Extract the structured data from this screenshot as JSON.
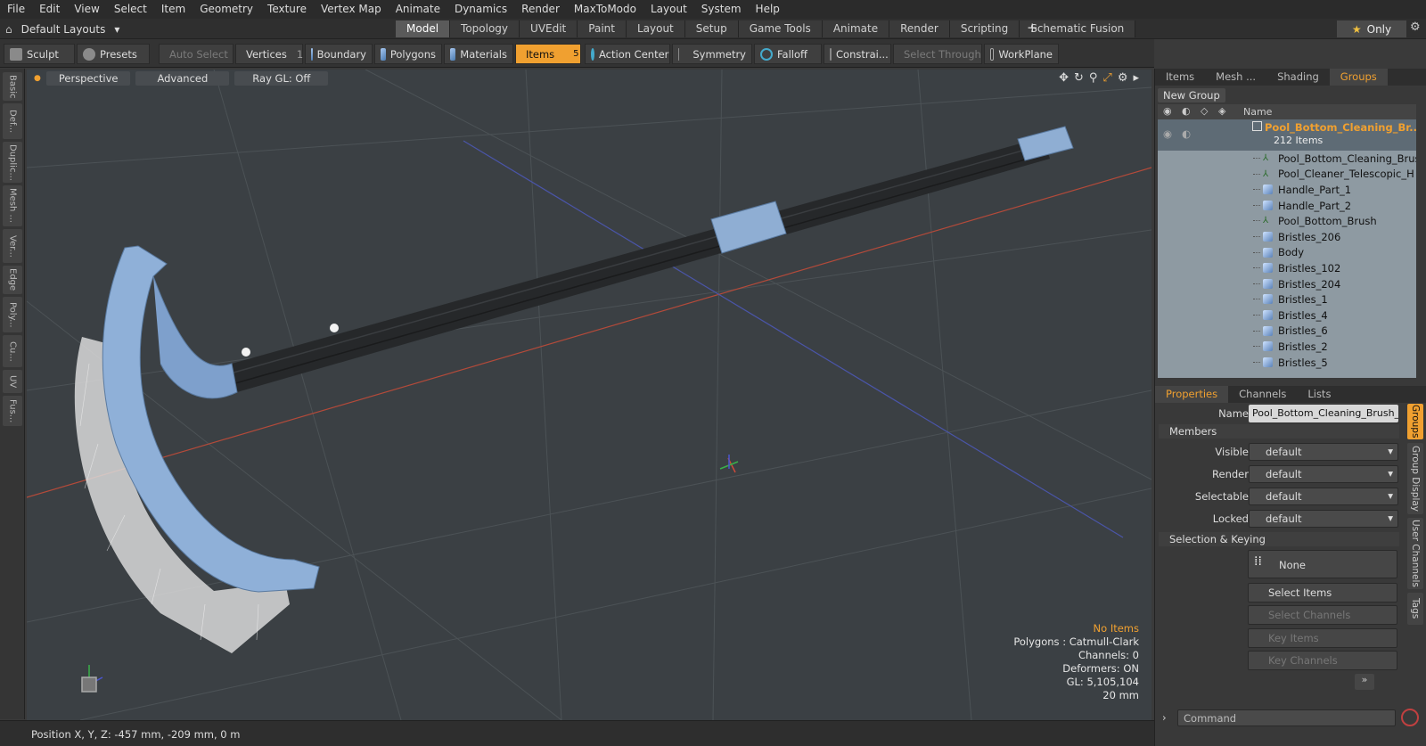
{
  "menu": [
    "File",
    "Edit",
    "View",
    "Select",
    "Item",
    "Geometry",
    "Texture",
    "Vertex Map",
    "Animate",
    "Dynamics",
    "Render",
    "MaxToModo",
    "Layout",
    "System",
    "Help"
  ],
  "layout_selector": "Default Layouts",
  "mode_tabs": [
    "Model",
    "Topology",
    "UVEdit",
    "Paint",
    "Layout",
    "Setup",
    "Game Tools",
    "Animate",
    "Render",
    "Scripting",
    "Schematic Fusion"
  ],
  "active_mode_tab": "Model",
  "only_label": "Only",
  "toolbar": {
    "sculpt": "Sculpt",
    "presets": "Presets",
    "auto_select": "Auto Select",
    "vertices": "Vertices",
    "vertices_count": "1",
    "boundary": "Boundary",
    "polygons": "Polygons",
    "materials": "Materials",
    "items": "Items",
    "items_count": "5",
    "action_center": "Action Center",
    "symmetry": "Symmetry",
    "falloff": "Falloff",
    "constraints": "Constrai...",
    "select_through": "Select Through",
    "workplane": "WorkPlane"
  },
  "left_tabs": [
    "Basic",
    "Def...",
    "Duplic...",
    "Mesh ...",
    "Ver...",
    "Edge",
    "Poly...",
    "Cu...",
    "UV",
    "Fus..."
  ],
  "viewport": {
    "view": "Perspective",
    "shading": "Advanced",
    "raygl": "Ray GL: Off",
    "info": {
      "selection": "No Items",
      "polygons": "Polygons : Catmull-Clark",
      "channels": "Channels: 0",
      "deformers": "Deformers: ON",
      "gl": "GL: 5,105,104",
      "scale": "20 mm"
    }
  },
  "status": "Position X, Y, Z:  -457 mm, -209 mm, 0 m",
  "panel_tabs": [
    "Items",
    "Mesh ...",
    "Shading",
    "Groups"
  ],
  "active_panel_tab": "Groups",
  "new_group": "New Group",
  "list_header": "Name",
  "group": {
    "name": "Pool_Bottom_Cleaning_Br...",
    "count": "212 Items"
  },
  "items": [
    {
      "name": "Pool_Bottom_Cleaning_Brus...",
      "type": "locator"
    },
    {
      "name": "Pool_Cleaner_Telescopic_H ...",
      "type": "locator"
    },
    {
      "name": "Handle_Part_1",
      "type": "mesh"
    },
    {
      "name": "Handle_Part_2",
      "type": "mesh"
    },
    {
      "name": "Pool_Bottom_Brush",
      "type": "locator"
    },
    {
      "name": "Bristles_206",
      "type": "mesh"
    },
    {
      "name": "Body",
      "type": "mesh"
    },
    {
      "name": "Bristles_102",
      "type": "mesh"
    },
    {
      "name": "Bristles_204",
      "type": "mesh"
    },
    {
      "name": "Bristles_1",
      "type": "mesh"
    },
    {
      "name": "Bristles_4",
      "type": "mesh"
    },
    {
      "name": "Bristles_6",
      "type": "mesh"
    },
    {
      "name": "Bristles_2",
      "type": "mesh"
    },
    {
      "name": "Bristles_5",
      "type": "mesh"
    }
  ],
  "props_tabs": [
    "Properties",
    "Channels",
    "Lists"
  ],
  "props": {
    "name_label": "Name",
    "name_value": "Pool_Bottom_Cleaning_Brush_wit",
    "members": "Members",
    "visible_label": "Visible",
    "visible_value": "default",
    "render_label": "Render",
    "render_value": "default",
    "selectable_label": "Selectable",
    "selectable_value": "default",
    "locked_label": "Locked",
    "locked_value": "default",
    "sel_keying": "Selection & Keying",
    "none_btn": "None",
    "select_items": "Select Items",
    "select_channels": "Select Channels",
    "key_items": "Key Items",
    "key_channels": "Key Channels"
  },
  "side_vtabs": [
    "Groups",
    "Group Display",
    "User Channels",
    "Tags"
  ],
  "command_placeholder": "Command"
}
